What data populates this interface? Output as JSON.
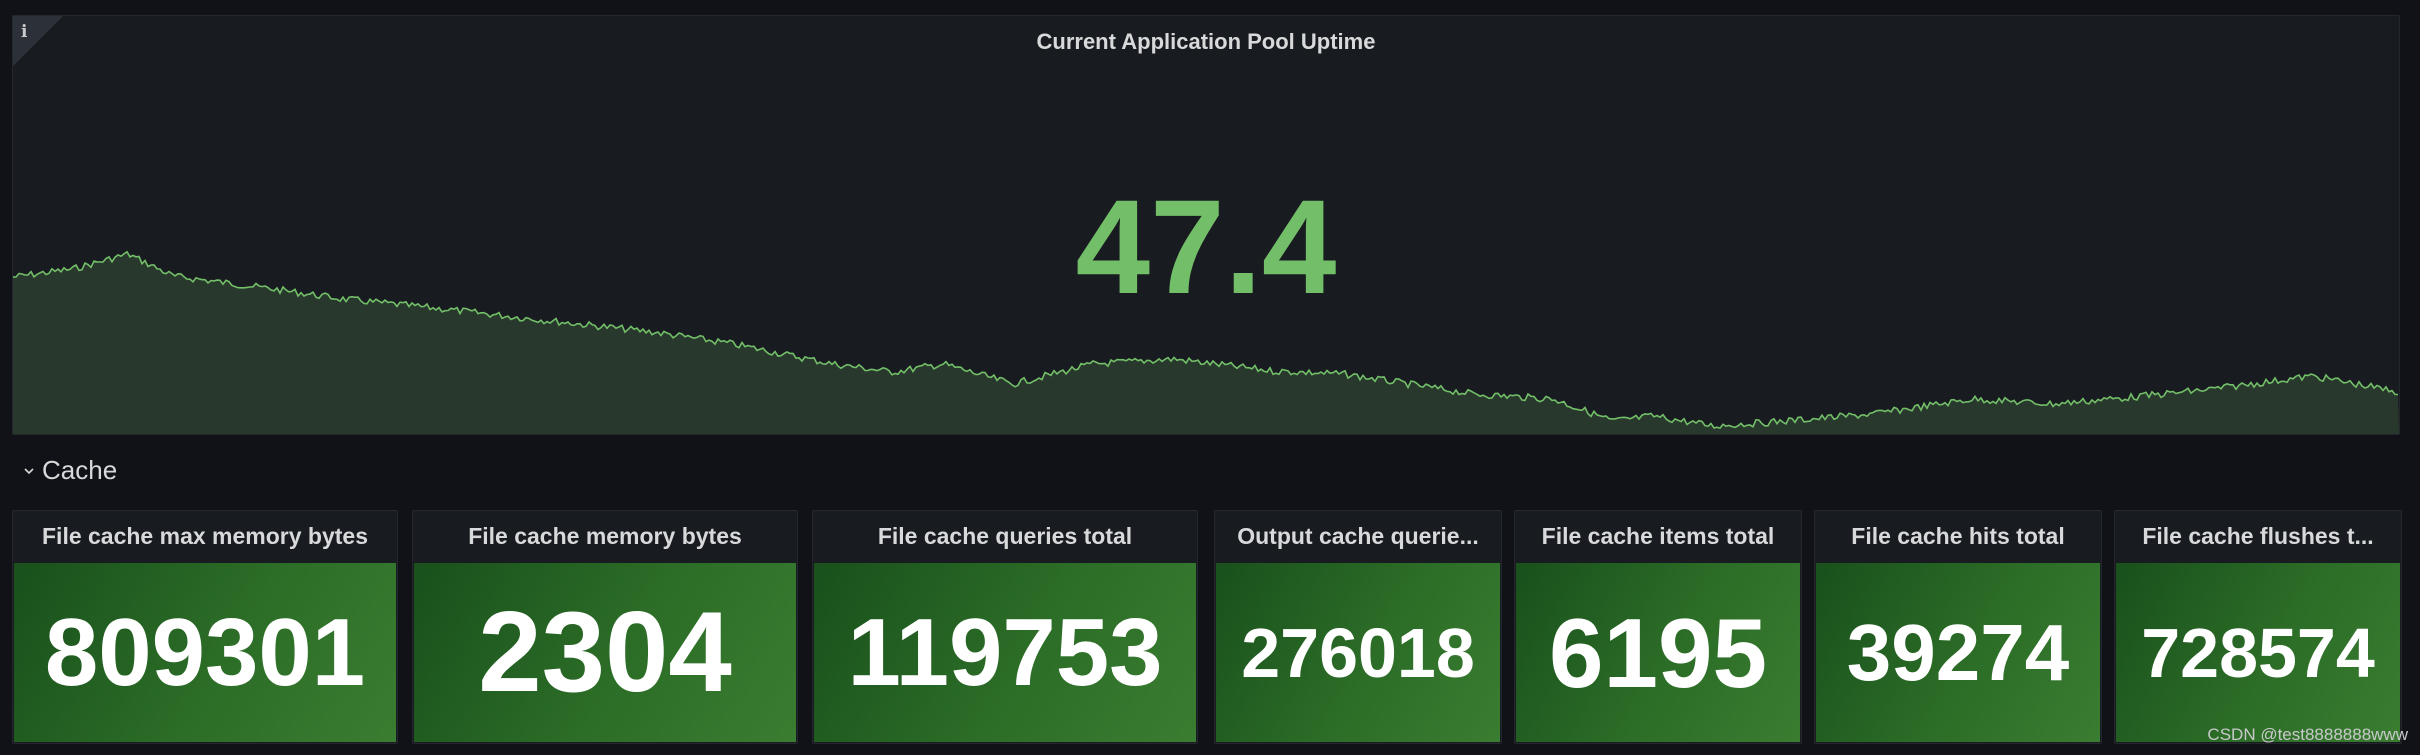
{
  "top_panel": {
    "title": "Current Application Pool Uptime",
    "value": "47.4",
    "accent_color": "#73bf69",
    "info_icon": "info-icon"
  },
  "row": {
    "title": "Cache",
    "collapse_icon": "chevron-down-icon"
  },
  "stats": [
    {
      "title": "File cache max memory bytes",
      "value": "809301"
    },
    {
      "title": "File cache memory bytes",
      "value": "2304"
    },
    {
      "title": "File cache queries total",
      "value": "119753"
    },
    {
      "title": "Output cache querie...",
      "value": "276018"
    },
    {
      "title": "File cache items total",
      "value": "6195"
    },
    {
      "title": "File cache hits total",
      "value": "39274"
    },
    {
      "title": "File cache flushes t...",
      "value": "728574"
    }
  ],
  "watermark": "CSDN @test8888888www",
  "colors": {
    "background": "#111217",
    "panel": "#181b1f",
    "stat_green": "#2c6d27",
    "sparkline": "#73bf69"
  }
}
